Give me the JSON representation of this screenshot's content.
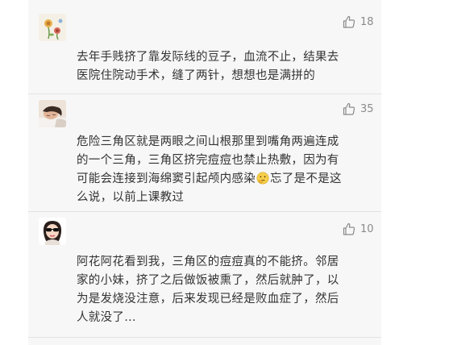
{
  "comments": [
    {
      "likes": "18",
      "avatar_icon": "flower-drawing-avatar",
      "lines": [
        "去年手贱挤了靠发际线的豆子，血流不止，结果去",
        "医院住院动手术，缝了两针，想想也是满拼的"
      ]
    },
    {
      "likes": "35",
      "avatar_icon": "person-photo-avatar",
      "lines": [
        "危险三角区就是两眼之间山根那里到嘴角两遍连成",
        "的一个三角，三角区挤完痘痘也禁止热敷，因为有",
        "可能会连接到海绵窦引起颅内感染",
        "忘了是不是这",
        "么说，以前上课教过"
      ],
      "emoji": "thinking-emoji"
    },
    {
      "likes": "10",
      "avatar_icon": "girl-with-sunglasses-avatar",
      "lines": [
        "阿花阿花看到我，三角区的痘痘真的不能挤。邻居",
        "家的小妹，挤了之后做饭被熏了，然后就肿了，以",
        "为是发烧没注意，后来发现已经是败血症了，然后",
        "人就没了..."
      ]
    }
  ],
  "colors": {
    "panel_bg": "#f7f7f7",
    "text": "#333333",
    "like": "#8a8a8a",
    "divider": "#e2e2e2"
  }
}
